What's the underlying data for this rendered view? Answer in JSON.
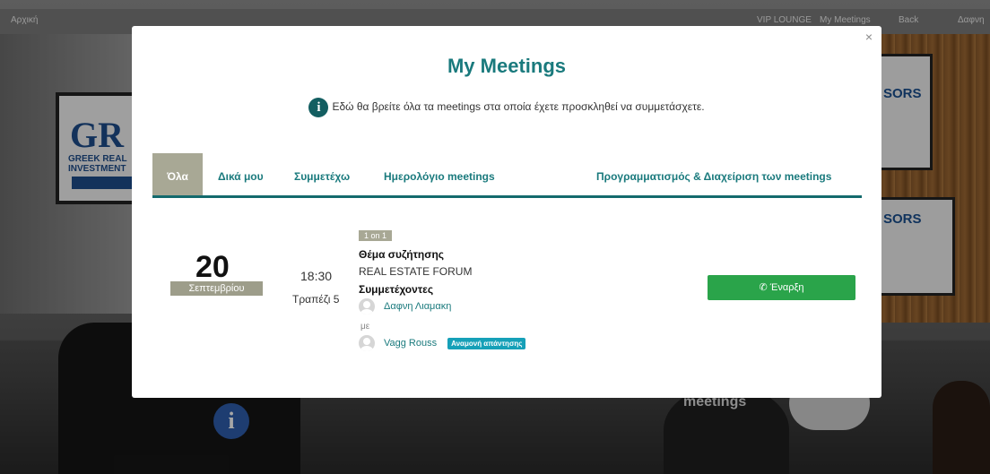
{
  "topbar": {
    "home": "Αρχική",
    "vip": "VIP LOUNGE",
    "meetings": "My Meetings",
    "back": "Back",
    "user": "Δαφνη"
  },
  "background": {
    "poster_logo": "GR",
    "poster_brand": "GREEK REAL INVESTMENT",
    "sponsors_1": "SORS",
    "sponsors_2": "SORS",
    "meetings_sign": "meetings",
    "info_glyph": "i"
  },
  "modal": {
    "close": "×",
    "title": "My Meetings",
    "info_icon": "info-icon",
    "info_text": "Εδώ θα βρείτε όλα τα meetings στα οποία έχετε προσκληθεί να συμμετάσχετε.",
    "tabs": [
      {
        "label": "Όλα",
        "active": true
      },
      {
        "label": "Δικά μου",
        "active": false
      },
      {
        "label": "Συμμετέχω",
        "active": false
      },
      {
        "label": "Ημερολόγιο meetings",
        "active": false
      },
      {
        "label": "Προγραμματισμός & Διαχείριση των meetings",
        "active": false
      }
    ]
  },
  "meeting": {
    "day": "20",
    "month": "Σεπτεμβρίου",
    "time": "18:30",
    "table": "Τραπέζι 5",
    "type": "1 on 1",
    "topic_label": "Θέμα συζήτησης",
    "forum": "REAL ESTATE FORUM",
    "participants_label": "Συμμετέχοντες",
    "host": "Δαφνη Λιαμακη",
    "with": "με",
    "guest": "Vagg Rouss",
    "status": "Αναμονή απάντησης",
    "start_button": "Έναρξη",
    "start_icon": "phone-icon"
  },
  "colors": {
    "accent": "#1a7a7d",
    "tab_active": "#a8a895",
    "start": "#2aa44a",
    "status": "#16a0b8"
  }
}
